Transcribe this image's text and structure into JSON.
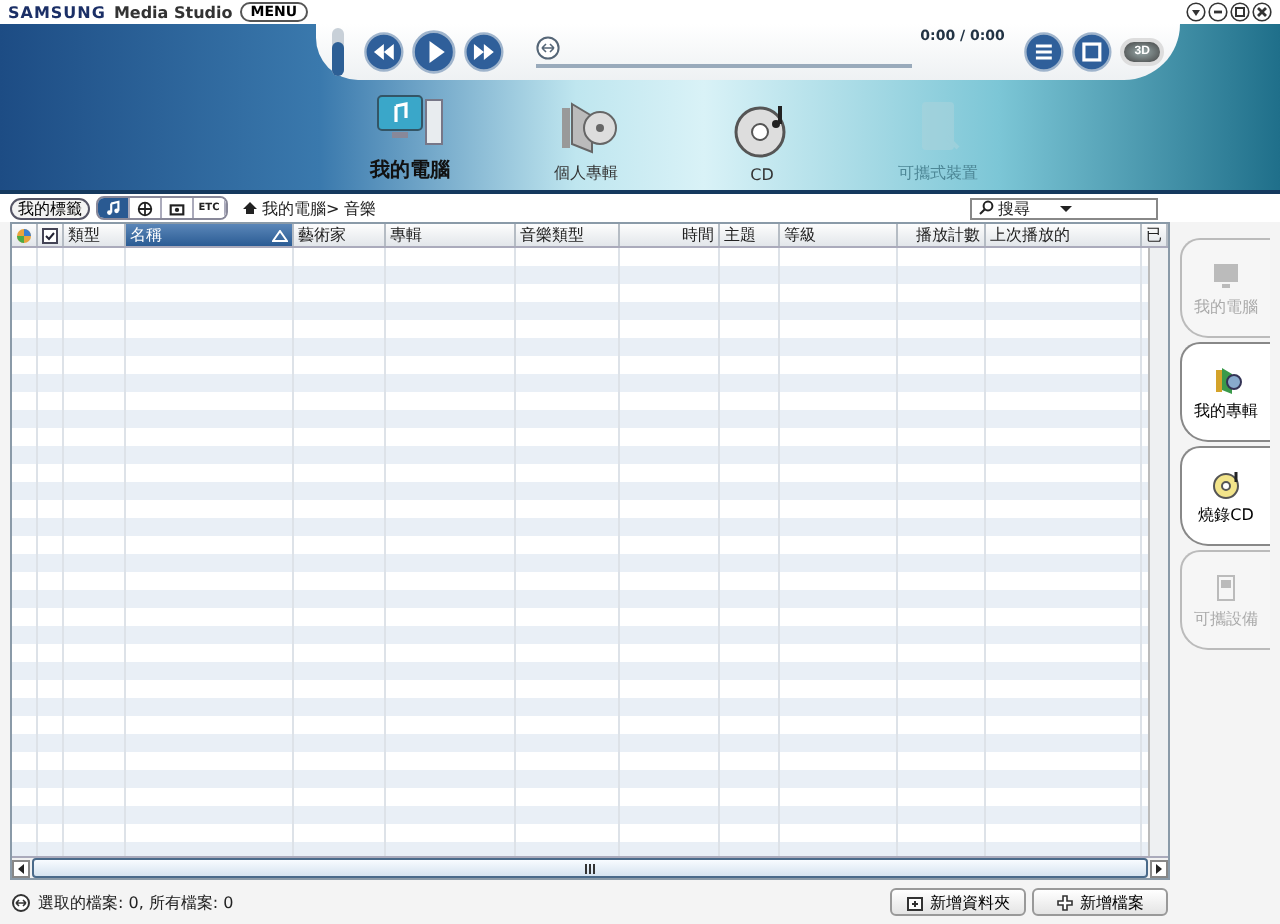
{
  "app": {
    "brand": "SAMSUNG",
    "title": "Media Studio",
    "menu_button": "MENU"
  },
  "player": {
    "volume": {
      "level": 0.7
    },
    "seek": {
      "level": 0
    },
    "time": "0:00 / 0:00",
    "mode_button": "3D"
  },
  "nav": [
    {
      "label": "我的電腦",
      "kind": "computer",
      "selected": true,
      "disabled": false
    },
    {
      "label": "個人專輯",
      "kind": "album",
      "selected": false,
      "disabled": false
    },
    {
      "label": "CD",
      "kind": "cd",
      "selected": false,
      "disabled": false
    },
    {
      "label": "可攜式裝置",
      "kind": "device",
      "selected": false,
      "disabled": true
    }
  ],
  "toolbar": {
    "tag_button": "我的標籤",
    "filters": [
      {
        "kind": "music",
        "selected": true
      },
      {
        "kind": "photo",
        "selected": false
      },
      {
        "kind": "video",
        "selected": false
      },
      {
        "kind": "etc",
        "label": "ETC",
        "selected": false
      }
    ],
    "breadcrumb": "我的電腦> 音樂",
    "search": {
      "placeholder": "搜尋"
    }
  },
  "table": {
    "columns": [
      {
        "kind": "status"
      },
      {
        "kind": "checkbox",
        "checked": true
      },
      {
        "kind": "text",
        "label": "類型",
        "sorted": false
      },
      {
        "kind": "text",
        "label": "名稱",
        "sorted": true
      },
      {
        "kind": "text",
        "label": "藝術家",
        "sorted": false
      },
      {
        "kind": "text",
        "label": "專輯",
        "sorted": false
      },
      {
        "kind": "text",
        "label": "音樂類型",
        "sorted": false
      },
      {
        "kind": "text",
        "label": "時間",
        "sorted": false
      },
      {
        "kind": "text",
        "label": "主題",
        "sorted": false
      },
      {
        "kind": "text",
        "label": "等級",
        "sorted": false
      },
      {
        "kind": "text",
        "label": "播放計數",
        "sorted": false
      },
      {
        "kind": "text",
        "label": "上次播放的",
        "sorted": false
      },
      {
        "kind": "text",
        "label": "已",
        "sorted": false
      }
    ]
  },
  "side_tabs": [
    {
      "label": "我的電腦",
      "kind": "computer",
      "disabled": true
    },
    {
      "label": "我的專輯",
      "kind": "album",
      "disabled": false
    },
    {
      "label": "燒錄CD",
      "kind": "cd",
      "disabled": false
    },
    {
      "label": "可攜設備",
      "kind": "device",
      "disabled": true
    }
  ],
  "status": "選取的檔案: 0, 所有檔案: 0",
  "buttons": [
    {
      "label": "新增資料夾",
      "kind": "folder"
    },
    {
      "label": "新增檔案",
      "kind": "add"
    }
  ]
}
